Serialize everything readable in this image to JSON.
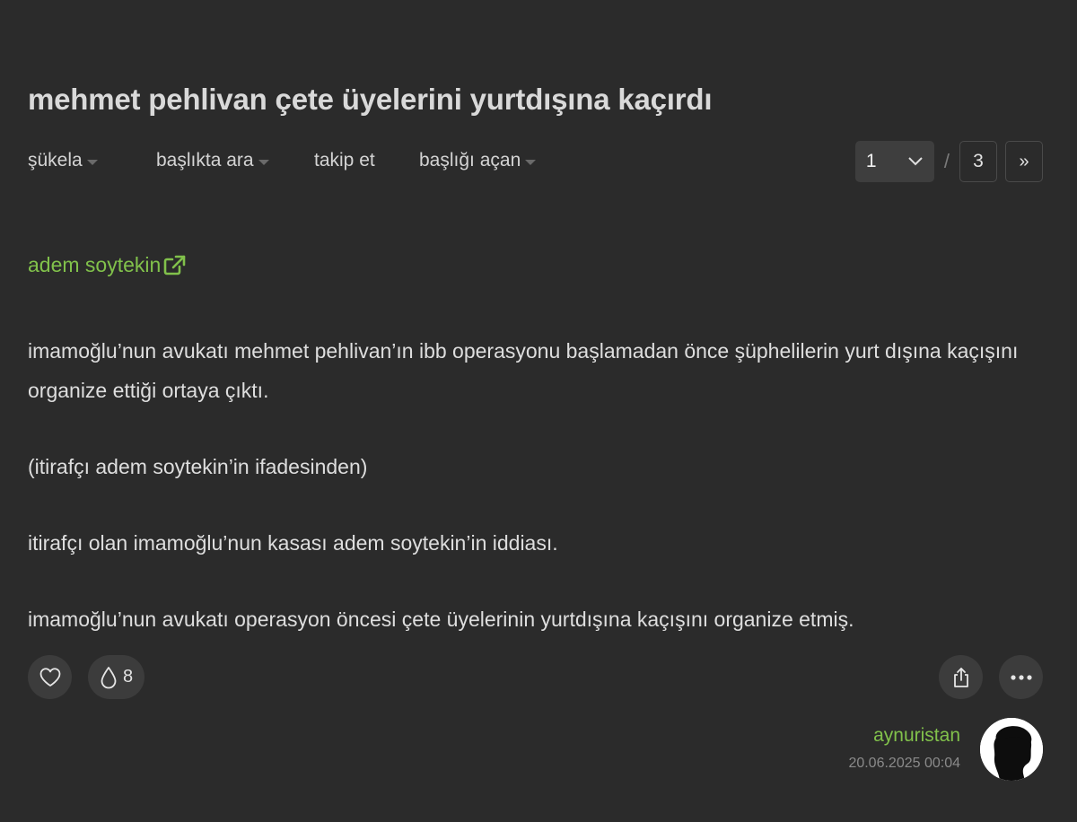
{
  "topic": {
    "title": "mehmet pehlivan çete üyelerini yurtdışına kaçırdı"
  },
  "nav": {
    "items": [
      {
        "label": "şükela",
        "dropdown": true
      },
      {
        "label": "başlıkta ara",
        "dropdown": true
      },
      {
        "label": "takip et",
        "dropdown": false
      },
      {
        "label": "başlığı açan",
        "dropdown": true
      }
    ]
  },
  "pager": {
    "current": "1",
    "separator": "/",
    "total": "3",
    "next_label": "»"
  },
  "entry": {
    "author_link": "adem soytekin",
    "paragraphs": [
      "imamoğlu’nun avukatı mehmet pehlivan’ın ibb operasyonu başlamadan önce şüphelilerin yurt dışına kaçışını organize ettiği ortaya çıktı.",
      "(itirafçı adem soytekin’in ifadesinden)",
      "itirafçı olan imamoğlu’nun kasası adem soytekin’in iddiası.",
      "imamoğlu’nun avukatı operasyon öncesi çete üyelerinin yurtdışına kaçışını organize etmiş."
    ],
    "drop_count": "8",
    "author_nick": "aynuristan",
    "date": "20.06.2025 00:04"
  },
  "icons": {
    "like": "heart-icon",
    "drop": "droplet-icon",
    "share": "share-icon",
    "more": "ellipsis-icon",
    "external": "external-link-icon",
    "select": "chevron-down-icon"
  },
  "colors": {
    "background": "#2b2b2b",
    "accent_green": "#81c14b",
    "button_bg": "#3c3c3c"
  }
}
